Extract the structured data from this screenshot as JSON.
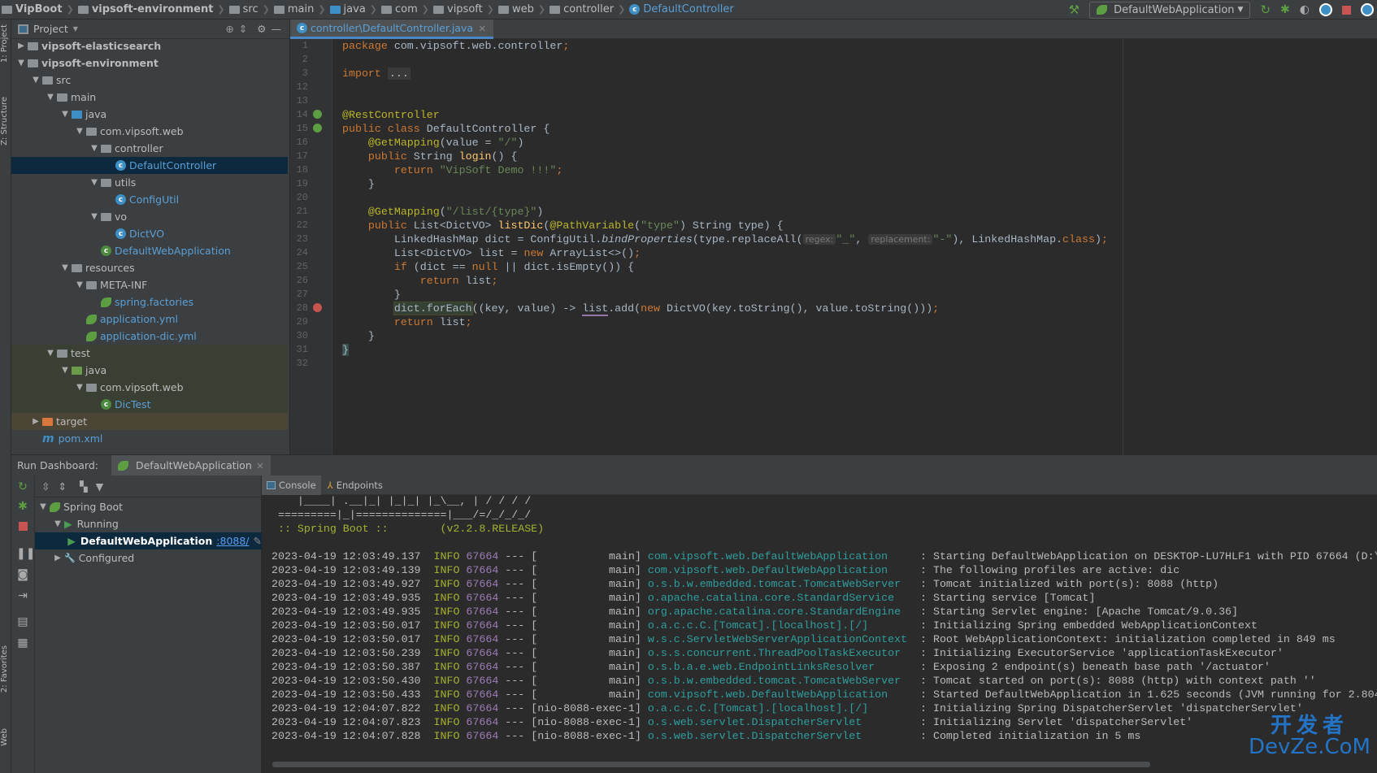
{
  "breadcrumb": [
    {
      "label": "VipBoot",
      "icon": "module-folder",
      "bold": true
    },
    {
      "label": "vipsoft-environment",
      "icon": "module-folder",
      "bold": true
    },
    {
      "label": "src",
      "icon": "folder"
    },
    {
      "label": "main",
      "icon": "folder"
    },
    {
      "label": "java",
      "icon": "source-folder"
    },
    {
      "label": "com",
      "icon": "package"
    },
    {
      "label": "vipsoft",
      "icon": "package"
    },
    {
      "label": "web",
      "icon": "package"
    },
    {
      "label": "controller",
      "icon": "package"
    },
    {
      "label": "DefaultController",
      "icon": "class",
      "accent": true
    }
  ],
  "toolbar": {
    "run_config": "DefaultWebApplication",
    "icons": [
      "build-hammer-icon",
      "rerun-icon",
      "debug-icon",
      "coverage-icon",
      "profiler-icon",
      "stop-icon"
    ]
  },
  "side_tabs": {
    "project": "1: Project",
    "structure": "Z: Structure",
    "favorites": "2: Favorites",
    "web": "Web"
  },
  "project": {
    "title": "Project",
    "tree": [
      {
        "label": "vipsoft-elasticsearch",
        "depth": 1,
        "arrow": "collapsed",
        "icon": "module",
        "bold": true
      },
      {
        "label": "vipsoft-environment",
        "depth": 1,
        "arrow": "expanded",
        "icon": "module",
        "bold": true
      },
      {
        "label": "src",
        "depth": 2,
        "arrow": "expanded",
        "icon": "folder"
      },
      {
        "label": "main",
        "depth": 3,
        "arrow": "expanded",
        "icon": "folder"
      },
      {
        "label": "java",
        "depth": 4,
        "arrow": "expanded",
        "icon": "source-folder"
      },
      {
        "label": "com.vipsoft.web",
        "depth": 5,
        "arrow": "expanded",
        "icon": "package"
      },
      {
        "label": "controller",
        "depth": 6,
        "arrow": "expanded",
        "icon": "package"
      },
      {
        "label": "DefaultController",
        "depth": 7,
        "icon": "class",
        "selected": true
      },
      {
        "label": "utils",
        "depth": 6,
        "arrow": "expanded",
        "icon": "package"
      },
      {
        "label": "ConfigUtil",
        "depth": 7,
        "icon": "class"
      },
      {
        "label": "vo",
        "depth": 6,
        "arrow": "expanded",
        "icon": "package"
      },
      {
        "label": "DictVO",
        "depth": 7,
        "icon": "class"
      },
      {
        "label": "DefaultWebApplication",
        "depth": 6,
        "icon": "spring-boot-class"
      },
      {
        "label": "resources",
        "depth": 4,
        "arrow": "expanded",
        "icon": "resources-folder"
      },
      {
        "label": "META-INF",
        "depth": 5,
        "arrow": "expanded",
        "icon": "package"
      },
      {
        "label": "spring.factories",
        "depth": 6,
        "icon": "spring-file"
      },
      {
        "label": "application.yml",
        "depth": 5,
        "icon": "spring-file"
      },
      {
        "label": "application-dic.yml",
        "depth": 5,
        "icon": "spring-file"
      },
      {
        "label": "test",
        "depth": 3,
        "arrow": "expanded",
        "icon": "folder",
        "zone": "test"
      },
      {
        "label": "java",
        "depth": 4,
        "arrow": "expanded",
        "icon": "test-folder",
        "zone": "test"
      },
      {
        "label": "com.vipsoft.web",
        "depth": 5,
        "arrow": "expanded",
        "icon": "package",
        "zone": "test"
      },
      {
        "label": "DicTest",
        "depth": 6,
        "icon": "spring-boot-class",
        "zone": "test"
      },
      {
        "label": "target",
        "depth": 2,
        "arrow": "collapsed",
        "icon": "excluded-folder",
        "zone": "excl"
      },
      {
        "label": "pom.xml",
        "depth": 2,
        "icon": "maven-file"
      }
    ]
  },
  "editor": {
    "tab": "controller\\DefaultController.java",
    "lines": [
      {
        "n": "1",
        "t": [
          [
            "package",
            "kw"
          ],
          [
            " com.vipsoft.web.controller",
            ""
          ],
          [
            ";",
            "kw"
          ]
        ]
      },
      {
        "n": "2",
        "t": []
      },
      {
        "n": "3",
        "t": [
          [
            "import",
            "kw"
          ],
          [
            " ",
            ""
          ],
          [
            "...",
            "foldtxt"
          ]
        ]
      },
      {
        "n": "12",
        "t": []
      },
      {
        "n": "13",
        "t": []
      },
      {
        "n": "14",
        "t": [
          [
            "@RestController",
            "ann"
          ]
        ],
        "gutter": "spring-bean-icon"
      },
      {
        "n": "15",
        "t": [
          [
            "public class ",
            "kw"
          ],
          [
            "DefaultController",
            ""
          ],
          [
            " {",
            ""
          ]
        ],
        "gutter": "spring-bean-icon"
      },
      {
        "n": "16",
        "t": [
          [
            "    ",
            ""
          ],
          [
            "@GetMapping",
            "ann"
          ],
          [
            "(value = ",
            ""
          ],
          [
            "\"/\"",
            "str"
          ],
          [
            ")",
            ""
          ]
        ]
      },
      {
        "n": "17",
        "t": [
          [
            "    ",
            ""
          ],
          [
            "public ",
            "kw"
          ],
          [
            "String ",
            ""
          ],
          [
            "login",
            "fn"
          ],
          [
            "() {",
            ""
          ]
        ]
      },
      {
        "n": "18",
        "t": [
          [
            "        ",
            ""
          ],
          [
            "return ",
            "kw"
          ],
          [
            "\"VipSoft Demo !!!\"",
            "str"
          ],
          [
            ";",
            "kw"
          ]
        ]
      },
      {
        "n": "19",
        "t": [
          [
            "    }",
            ""
          ]
        ]
      },
      {
        "n": "20",
        "t": []
      },
      {
        "n": "21",
        "t": [
          [
            "    ",
            ""
          ],
          [
            "@GetMapping",
            "ann"
          ],
          [
            "(",
            ""
          ],
          [
            "\"/list/{type}\"",
            "str"
          ],
          [
            ")",
            ""
          ]
        ]
      },
      {
        "n": "22",
        "t": [
          [
            "    ",
            ""
          ],
          [
            "public ",
            "kw"
          ],
          [
            "List<DictVO> ",
            ""
          ],
          [
            "listDic",
            "fn"
          ],
          [
            "(",
            ""
          ],
          [
            "@PathVariable",
            "ann"
          ],
          [
            "(",
            ""
          ],
          [
            "\"type\"",
            "str"
          ],
          [
            ") String type) {",
            ""
          ]
        ]
      },
      {
        "n": "23",
        "t": [
          [
            "        LinkedHashMap dict = ConfigUtil.",
            ""
          ],
          [
            "bindProperties",
            "it"
          ],
          [
            "(type.replaceAll(",
            ""
          ],
          [
            "regex:",
            "hint"
          ],
          [
            "\"_\"",
            "str"
          ],
          [
            ", ",
            ""
          ],
          [
            "replacement:",
            "hint"
          ],
          [
            "\"-\"",
            "str"
          ],
          [
            "), LinkedHashMap.",
            ""
          ],
          [
            "class",
            "kw"
          ],
          [
            ")",
            ""
          ],
          [
            ";",
            "kw"
          ]
        ]
      },
      {
        "n": "24",
        "t": [
          [
            "        List<DictVO> list = ",
            ""
          ],
          [
            "new ",
            "kw"
          ],
          [
            "ArrayList<>()",
            ""
          ],
          [
            ";",
            "kw"
          ]
        ]
      },
      {
        "n": "25",
        "t": [
          [
            "        ",
            ""
          ],
          [
            "if ",
            "kw"
          ],
          [
            "(dict == ",
            ""
          ],
          [
            "null ",
            "kw"
          ],
          [
            "|| dict.isEmpty()) {",
            ""
          ]
        ]
      },
      {
        "n": "26",
        "t": [
          [
            "            ",
            ""
          ],
          [
            "return ",
            "kw"
          ],
          [
            "list",
            ""
          ],
          [
            ";",
            "kw"
          ]
        ]
      },
      {
        "n": "27",
        "t": [
          [
            "        }",
            ""
          ]
        ]
      },
      {
        "n": "28",
        "t": [
          [
            "        ",
            ""
          ],
          [
            "dict.forEach",
            "hl"
          ],
          [
            "((key, value) -> ",
            ""
          ],
          [
            "list",
            "ul"
          ],
          [
            ".add(",
            ""
          ],
          [
            "new ",
            "kw"
          ],
          [
            "DictVO(key.toString(), value.toString()))",
            ""
          ],
          [
            ";",
            "kw"
          ]
        ],
        "gutter": "lambda-breakpoint-icon"
      },
      {
        "n": "29",
        "t": [
          [
            "        ",
            ""
          ],
          [
            "return ",
            "kw"
          ],
          [
            "list",
            ""
          ],
          [
            ";",
            "kw"
          ]
        ]
      },
      {
        "n": "30",
        "t": [
          [
            "    }",
            ""
          ]
        ]
      },
      {
        "n": "31",
        "t": [
          [
            "}",
            "cur"
          ]
        ]
      },
      {
        "n": "32",
        "t": []
      }
    ]
  },
  "run_dashboard": {
    "title": "Run Dashboard:",
    "tab": "DefaultWebApplication",
    "tree": [
      {
        "label": "Spring Boot",
        "depth": 0,
        "arrow": "expanded",
        "icon": "spring-boot-icon"
      },
      {
        "label": "Running",
        "depth": 1,
        "arrow": "expanded",
        "icon": "run-icon"
      },
      {
        "label": "DefaultWebApplication",
        "depth": 2,
        "icon": "run-icon",
        "bold": true,
        "selected": true,
        "link": ":8088/"
      },
      {
        "label": "Configured",
        "depth": 1,
        "arrow": "collapsed",
        "icon": "wrench-icon"
      }
    ]
  },
  "console": {
    "tabs": [
      "Console",
      "Endpoints"
    ],
    "banner": [
      "    |____| .__|_| |_|_| |_\\__, | / / / /",
      " =========|_|==============|___/=/_/_/_/",
      " :: Spring Boot ::        (v2.2.8.RELEASE)"
    ],
    "logs": [
      {
        "time": "2023-04-19 12:03:49.137",
        "level": "INFO",
        "pid": "67664",
        "thread": "[           main]",
        "logger": "com.vipsoft.web.DefaultWebApplication    ",
        "msg": ": Starting DefaultWebApplication on DESKTOP-LU7HLF1 with PID 67664 (D:\\"
      },
      {
        "time": "2023-04-19 12:03:49.139",
        "level": "INFO",
        "pid": "67664",
        "thread": "[           main]",
        "logger": "com.vipsoft.web.DefaultWebApplication    ",
        "msg": ": The following profiles are active: dic"
      },
      {
        "time": "2023-04-19 12:03:49.927",
        "level": "INFO",
        "pid": "67664",
        "thread": "[           main]",
        "logger": "o.s.b.w.embedded.tomcat.TomcatWebServer  ",
        "msg": ": Tomcat initialized with port(s): 8088 (http)"
      },
      {
        "time": "2023-04-19 12:03:49.935",
        "level": "INFO",
        "pid": "67664",
        "thread": "[           main]",
        "logger": "o.apache.catalina.core.StandardService   ",
        "msg": ": Starting service [Tomcat]"
      },
      {
        "time": "2023-04-19 12:03:49.935",
        "level": "INFO",
        "pid": "67664",
        "thread": "[           main]",
        "logger": "org.apache.catalina.core.StandardEngine  ",
        "msg": ": Starting Servlet engine: [Apache Tomcat/9.0.36]"
      },
      {
        "time": "2023-04-19 12:03:50.017",
        "level": "INFO",
        "pid": "67664",
        "thread": "[           main]",
        "logger": "o.a.c.c.C.[Tomcat].[localhost].[/]       ",
        "msg": ": Initializing Spring embedded WebApplicationContext"
      },
      {
        "time": "2023-04-19 12:03:50.017",
        "level": "INFO",
        "pid": "67664",
        "thread": "[           main]",
        "logger": "w.s.c.ServletWebServerApplicationContext ",
        "msg": ": Root WebApplicationContext: initialization completed in 849 ms"
      },
      {
        "time": "2023-04-19 12:03:50.239",
        "level": "INFO",
        "pid": "67664",
        "thread": "[           main]",
        "logger": "o.s.s.concurrent.ThreadPoolTaskExecutor  ",
        "msg": ": Initializing ExecutorService 'applicationTaskExecutor'"
      },
      {
        "time": "2023-04-19 12:03:50.387",
        "level": "INFO",
        "pid": "67664",
        "thread": "[           main]",
        "logger": "o.s.b.a.e.web.EndpointLinksResolver      ",
        "msg": ": Exposing 2 endpoint(s) beneath base path '/actuator'"
      },
      {
        "time": "2023-04-19 12:03:50.430",
        "level": "INFO",
        "pid": "67664",
        "thread": "[           main]",
        "logger": "o.s.b.w.embedded.tomcat.TomcatWebServer  ",
        "msg": ": Tomcat started on port(s): 8088 (http) with context path ''"
      },
      {
        "time": "2023-04-19 12:03:50.433",
        "level": "INFO",
        "pid": "67664",
        "thread": "[           main]",
        "logger": "com.vipsoft.web.DefaultWebApplication    ",
        "msg": ": Started DefaultWebApplication in 1.625 seconds (JVM running for 2.804"
      },
      {
        "time": "2023-04-19 12:04:07.822",
        "level": "INFO",
        "pid": "67664",
        "thread": "[nio-8088-exec-1]",
        "logger": "o.a.c.c.C.[Tomcat].[localhost].[/]       ",
        "msg": ": Initializing Spring DispatcherServlet 'dispatcherServlet'"
      },
      {
        "time": "2023-04-19 12:04:07.823",
        "level": "INFO",
        "pid": "67664",
        "thread": "[nio-8088-exec-1]",
        "logger": "o.s.web.servlet.DispatcherServlet        ",
        "msg": ": Initializing Servlet 'dispatcherServlet'"
      },
      {
        "time": "2023-04-19 12:04:07.828",
        "level": "INFO",
        "pid": "67664",
        "thread": "[nio-8088-exec-1]",
        "logger": "o.s.web.servlet.DispatcherServlet        ",
        "msg": ": Completed initialization in 5 ms"
      }
    ]
  },
  "watermark": {
    "cn": "开发者",
    "en": "DevZe.CoM"
  },
  "colors": {
    "keyword": "#cc7832",
    "string": "#6a8759",
    "annotation": "#bbb529",
    "info": "#a6b22f",
    "logger": "#2e9e9e",
    "selection": "#0d293e",
    "accent": "#4a88c7"
  }
}
